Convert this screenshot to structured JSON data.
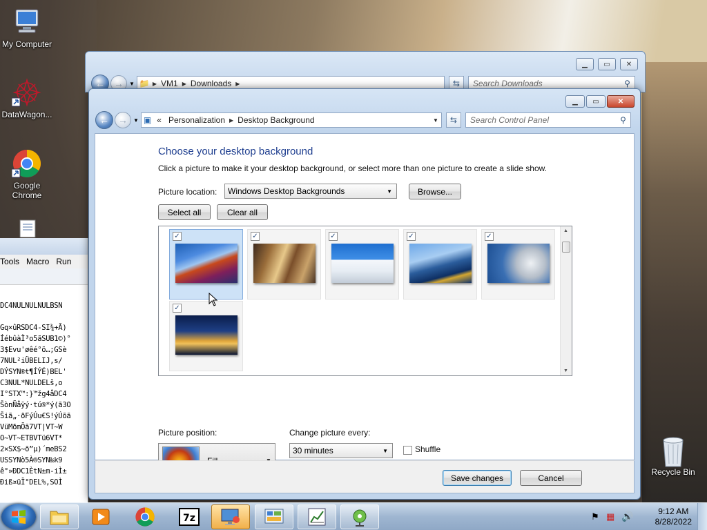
{
  "desktop": {
    "icons": [
      {
        "label": "My Computer"
      },
      {
        "label": "DataWagon..."
      },
      {
        "label": "Google Chrome"
      },
      {
        "label": "Recycle Bin"
      }
    ]
  },
  "background_app": {
    "menu": [
      "Tools",
      "Macro",
      "Run"
    ],
    "rows": [
      "DC4NULNULNULBSN",
      "",
      "Gq×ûRSDC4-SI¾+Ã)",
      "ÍébûàÌ³o5ãSUB1©)°",
      "3$Evu'øêé°õ…;GSè",
      "7NUL²iÜBELIJ,s/",
      "DÝSYN®t¶ÍÝÉ)BEL'",
      "C3NUL*NULDELš,o",
      "I°STX™:}™žg4åDC4",
      "ŠònÑåÿý·tú®*ý(ã3O",
      "Šiã„·ðFýÚu€S!ýÚõã",
      "VüMðmÕã7VT|VT~W",
      "O~VT~ETBVTü6VT*",
      "2×SX$~õ”µ)´meBS2",
      "USSYNò5À®SYN‰k9",
      "ê°»ÐDC1ÈtN±m-iÌ±",
      "Ðiß¤üÏ°DEL%,SOÌ"
    ]
  },
  "back_window": {
    "address": [
      "VM1",
      "Downloads"
    ],
    "search_placeholder": "Search Downloads"
  },
  "window": {
    "address": {
      "prefix": "«",
      "segments": [
        "Personalization",
        "Desktop Background"
      ]
    },
    "search_placeholder": "Search Control Panel",
    "heading": "Choose your desktop background",
    "subtitle": "Click a picture to make it your desktop background, or select more than one picture to create a slide show.",
    "picture_location_label": "Picture location:",
    "picture_location_value": "Windows Desktop Backgrounds",
    "browse_label": "Browse...",
    "select_all_label": "Select all",
    "clear_all_label": "Clear all",
    "picture_position_label": "Picture position:",
    "picture_position_value": "Fill",
    "change_every_label": "Change picture every:",
    "change_every_value": "30 minutes",
    "shuffle_label": "Shuffle",
    "save_label": "Save changes",
    "cancel_label": "Cancel",
    "check_mark": "✓"
  },
  "taskbar": {
    "time": "9:12 AM",
    "date": "8/28/2022"
  }
}
